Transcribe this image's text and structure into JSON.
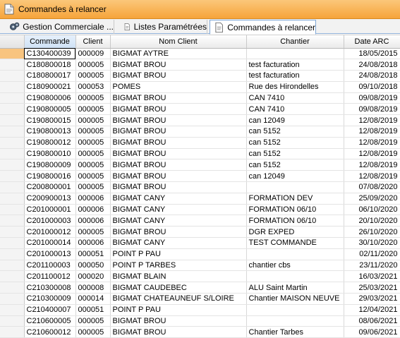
{
  "window": {
    "title": "Commandes à relancer"
  },
  "tabs": [
    {
      "label": "Gestion Commerciale ...",
      "icon": "gears-icon"
    },
    {
      "label": "Listes Paramétrées",
      "icon": "document-icon"
    },
    {
      "label": "Commandes à relancer",
      "icon": "document-icon",
      "active": true
    }
  ],
  "grid": {
    "columns": [
      "Commande",
      "Client",
      "Nom Client",
      "Chantier",
      "Date ARC"
    ],
    "rows": [
      [
        "C130400039",
        "000009",
        "BIGMAT AYTRE",
        "",
        "18/05/2015"
      ],
      [
        "C180800018",
        "000005",
        "BIGMAT BROU",
        "test facturation",
        "24/08/2018"
      ],
      [
        "C180800017",
        "000005",
        "BIGMAT BROU",
        "test facturation",
        "24/08/2018"
      ],
      [
        "C180900021",
        "000053",
        "POMES",
        "Rue des Hirondelles",
        "09/10/2018"
      ],
      [
        "C190800006",
        "000005",
        "BIGMAT BROU",
        "CAN 7410",
        "09/08/2019"
      ],
      [
        "C190800005",
        "000005",
        "BIGMAT BROU",
        "CAN 7410",
        "09/08/2019"
      ],
      [
        "C190800015",
        "000005",
        "BIGMAT BROU",
        "can 12049",
        "12/08/2019"
      ],
      [
        "C190800013",
        "000005",
        "BIGMAT BROU",
        "can 5152",
        "12/08/2019"
      ],
      [
        "C190800012",
        "000005",
        "BIGMAT BROU",
        "can 5152",
        "12/08/2019"
      ],
      [
        "C190800010",
        "000005",
        "BIGMAT BROU",
        "can 5152",
        "12/08/2019"
      ],
      [
        "C190800009",
        "000005",
        "BIGMAT BROU",
        "can 5152",
        "12/08/2019"
      ],
      [
        "C190800016",
        "000005",
        "BIGMAT BROU",
        "can 12049",
        "12/08/2019"
      ],
      [
        "C200800001",
        "000005",
        "BIGMAT BROU",
        "",
        "07/08/2020"
      ],
      [
        "C200900013",
        "000006",
        "BIGMAT CANY",
        "FORMATION DEV",
        "25/09/2020"
      ],
      [
        "C201000001",
        "000006",
        "BIGMAT CANY",
        "FORMATION 06/10",
        "06/10/2020"
      ],
      [
        "C201000003",
        "000006",
        "BIGMAT CANY",
        "FORMATION 06/10",
        "20/10/2020"
      ],
      [
        "C201000012",
        "000005",
        "BIGMAT BROU",
        "DGR EXPED",
        "26/10/2020"
      ],
      [
        "C201000014",
        "000006",
        "BIGMAT CANY",
        "TEST COMMANDE",
        "30/10/2020"
      ],
      [
        "C201000013",
        "000051",
        "POINT P PAU",
        "",
        "02/11/2020"
      ],
      [
        "C201100003",
        "000050",
        "POINT P TARBES",
        "chantier cbs",
        "23/11/2020"
      ],
      [
        "C201100012",
        "000020",
        "BIGMAT BLAIN",
        "",
        "16/03/2021"
      ],
      [
        "C210300008",
        "000008",
        "BIGMAT CAUDEBEC",
        "ALU Saint Martin",
        "25/03/2021"
      ],
      [
        "C210300009",
        "000014",
        "BIGMAT CHATEAUNEUF S/LOIRE",
        "Chantier MAISON NEUVE",
        "29/03/2021"
      ],
      [
        "C210400007",
        "000051",
        "POINT P PAU",
        "",
        "12/04/2021"
      ],
      [
        "C210600005",
        "000005",
        "BIGMAT BROU",
        "",
        "08/06/2021"
      ],
      [
        "C210600012",
        "000005",
        "BIGMAT BROU",
        "Chantier Tarbes",
        "09/06/2021"
      ]
    ]
  }
}
